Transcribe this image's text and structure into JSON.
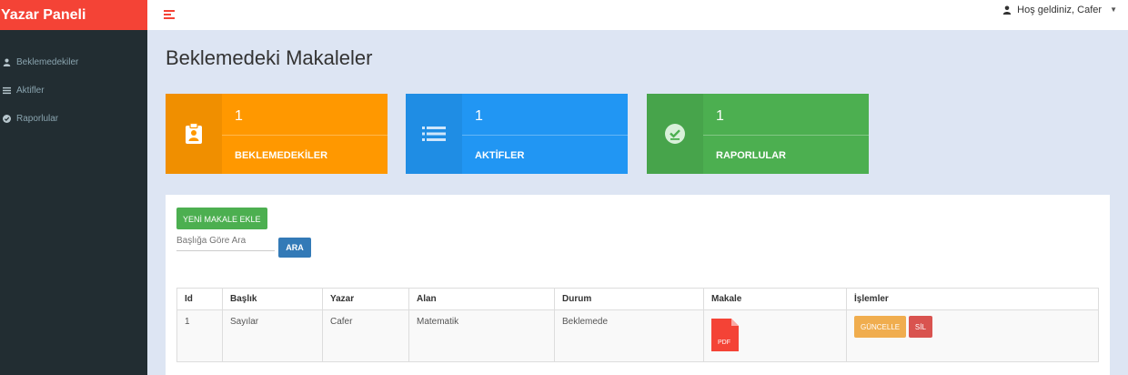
{
  "app": {
    "brand": "Yazar Paneli"
  },
  "header": {
    "user_greeting": "Hoş geldiniz, Cafer"
  },
  "sidebar": {
    "items": [
      {
        "label": "Beklemedekiler",
        "icon": "user-icon"
      },
      {
        "label": "Aktifler",
        "icon": "list-icon"
      },
      {
        "label": "Raporlular",
        "icon": "check-circle-icon"
      }
    ]
  },
  "main": {
    "title": "Beklemedeki Makaleler",
    "cards": [
      {
        "count": "1",
        "label": "BEKLEMEDEKİLER",
        "color": "#ff9800",
        "icon": "clipboard-user-icon"
      },
      {
        "count": "1",
        "label": "AKTİFLER",
        "color": "#2196f3",
        "icon": "list-icon"
      },
      {
        "count": "1",
        "label": "RAPORLULAR",
        "color": "#4caf50",
        "icon": "check-circle-icon"
      }
    ],
    "new_button": "YENİ MAKALE EKLE",
    "search": {
      "placeholder": "Başlığa Göre Ara",
      "button": "ARA"
    },
    "table": {
      "columns": [
        "Id",
        "Başlık",
        "Yazar",
        "Alan",
        "Durum",
        "Makale",
        "İşlemler"
      ],
      "rows": [
        {
          "id": "1",
          "title": "Sayılar",
          "author": "Cafer",
          "field": "Matematik",
          "status": "Beklemede",
          "file": "PDF",
          "update_label": "GÜNCELLE",
          "delete_label": "SİL"
        }
      ]
    }
  },
  "colors": {
    "brand": "#f44336",
    "sidebar": "#222d32",
    "background": "#dde5f3"
  }
}
